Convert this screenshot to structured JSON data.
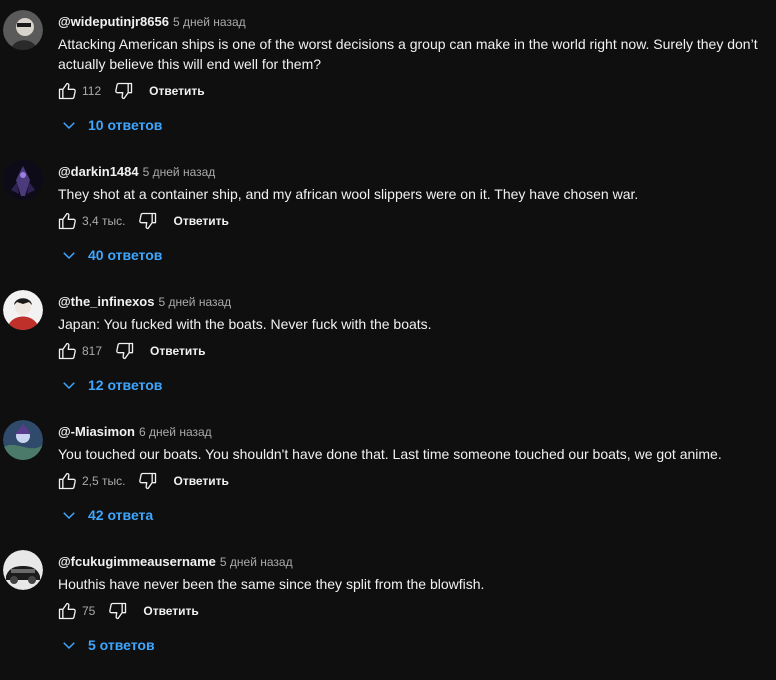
{
  "reply_button_label": "Ответить",
  "comments": [
    {
      "author": "@wideputinjr8656",
      "time": "5 дней назад",
      "text": "Attacking American ships is one of the worst decisions a group can make in the world right now. Surely they don’t actually believe this will end well for them?",
      "likes": "112",
      "replies": "10 ответов",
      "avatar_color": "#8a8a8a"
    },
    {
      "author": "@darkin1484",
      "time": "5 дней назад",
      "text": "They shot at a container ship, and my african wool slippers were on it. They have chosen war.",
      "likes": "3,4 тыс.",
      "replies": "40 ответов",
      "avatar_color": "#3a2c5c"
    },
    {
      "author": "@the_infinexos",
      "time": "5 дней назад",
      "text": "Japan: You fucked with the boats. Never fuck with the boats.",
      "likes": "817",
      "replies": "12 ответов",
      "avatar_color": "#c0302a"
    },
    {
      "author": "@-Miasimon",
      "time": "6 дней назад",
      "text": "You touched our boats. You shouldn't have done that. Last time someone touched our boats, we got anime.",
      "likes": "2,5 тыс.",
      "replies": "42 ответа",
      "avatar_color": "#2f4a6a"
    },
    {
      "author": "@fcukugimmeausername",
      "time": "5 дней назад",
      "text": "Houthis have never been the same since they split from the blowfish.",
      "likes": "75",
      "replies": "5 ответов",
      "avatar_color": "#6a6a6a"
    }
  ]
}
